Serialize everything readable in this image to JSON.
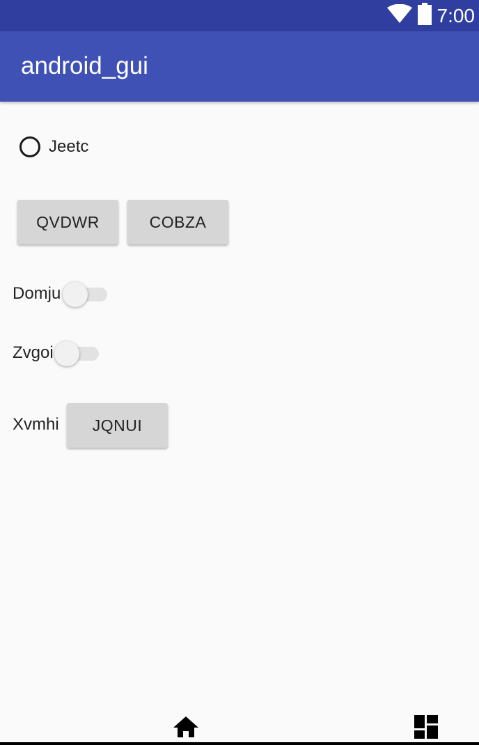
{
  "status_bar": {
    "time": "7:00",
    "icons": [
      "wifi-icon",
      "battery-icon"
    ]
  },
  "app_bar": {
    "title": "android_gui"
  },
  "radio": {
    "label": "Jeetc",
    "checked": false
  },
  "buttons": {
    "first": "QVDWR",
    "second": "COBZA",
    "third": "JQNUI"
  },
  "switches": [
    {
      "label": "Domju",
      "on": false
    },
    {
      "label": "Zvgoi",
      "on": false
    }
  ],
  "xvmhi_label": "Xvmhi",
  "bottom_nav": {
    "icons": [
      "home-icon",
      "dashboard-icon"
    ]
  },
  "colors": {
    "status_bar": "#303f9f",
    "app_bar": "#3f51b5",
    "background": "#fafafa",
    "button": "#d6d6d6"
  }
}
